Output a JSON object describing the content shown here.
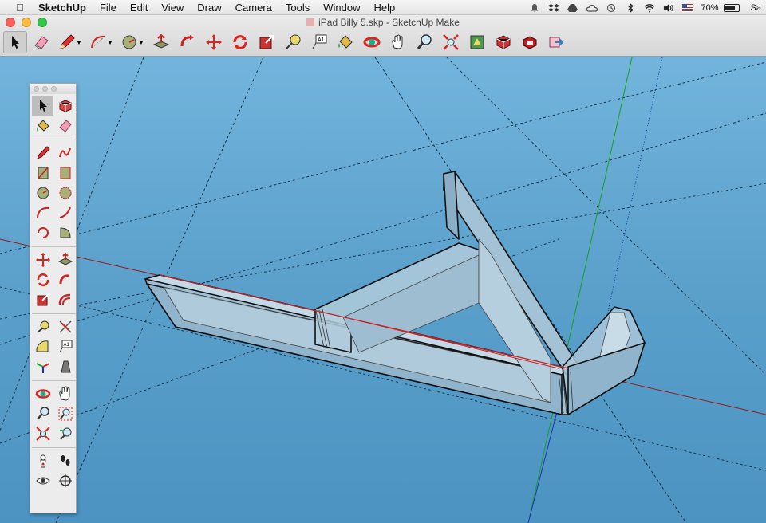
{
  "menubar": {
    "app_name": "SketchUp",
    "items": [
      "File",
      "Edit",
      "View",
      "Draw",
      "Camera",
      "Tools",
      "Window",
      "Help"
    ],
    "battery_text": "70%",
    "clock_text": "Sa"
  },
  "window": {
    "title": "iPad Billy 5.skp - SketchUp Make"
  },
  "toolbar": {
    "tools": [
      "select",
      "eraser",
      "pencil",
      "arc",
      "circle",
      "push-pull",
      "follow-me",
      "move",
      "rotate",
      "scale",
      "tape-measure",
      "text",
      "paint-bucket",
      "orbit",
      "pan",
      "zoom",
      "zoom-extents",
      "warehouse",
      "components",
      "extension-warehouse",
      "share-model"
    ],
    "active_tool": "select"
  },
  "palette": {
    "groups": [
      [
        "select",
        "make-component",
        "paint-bucket",
        "eraser"
      ],
      [
        "line",
        "freehand",
        "rectangle",
        "rotated-rectangle",
        "circle",
        "polygon",
        "arc",
        "2-point-arc",
        "3-point-arc",
        "pie"
      ],
      [
        "move",
        "push-pull",
        "rotate",
        "follow-me",
        "scale",
        "offset"
      ],
      [
        "tape-measure",
        "dimension",
        "protractor",
        "text",
        "axes",
        "3d-text"
      ],
      [
        "orbit",
        "pan",
        "zoom",
        "zoom-window",
        "zoom-extents",
        "previous-view"
      ],
      [
        "position-camera",
        "walk",
        "look-around",
        "section-plane"
      ]
    ]
  },
  "colors": {
    "sky": "#5aa0cb",
    "model_fill": "#a9c7da",
    "accent_red": "#cc2020"
  }
}
